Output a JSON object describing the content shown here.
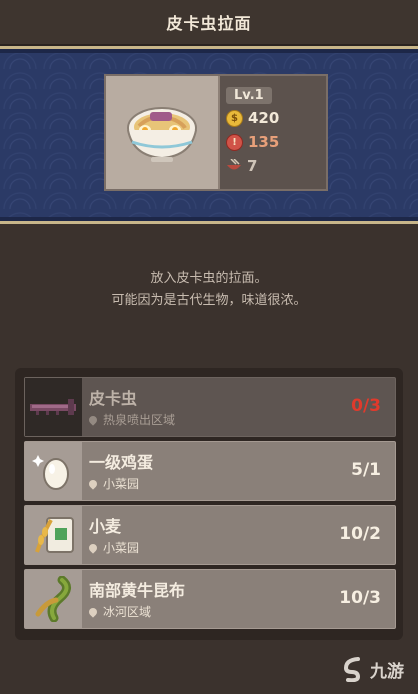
{
  "header": {
    "title": "皮卡虫拉面"
  },
  "dish": {
    "level": "Lv.1",
    "price": "420",
    "popularity": "135",
    "servings": "7",
    "colors": {
      "price": "#f2e8d8",
      "popularity": "#e8a07a",
      "servings": "#cfc4b8"
    }
  },
  "description": {
    "line1": "放入皮卡虫的拉面。",
    "line2": "可能因为是古代生物，味道很浓。"
  },
  "ingredients": [
    {
      "name": "皮卡虫",
      "location": "热泉喷出区域",
      "count": "0/3",
      "icon": "pikabug-icon",
      "sufficient": false
    },
    {
      "name": "一级鸡蛋",
      "location": "小菜园",
      "count": "5/1",
      "icon": "egg-icon",
      "sufficient": true
    },
    {
      "name": "小麦",
      "location": "小菜园",
      "count": "10/2",
      "icon": "wheat-icon",
      "sufficient": true
    },
    {
      "name": "南部黄牛昆布",
      "location": "冰河区域",
      "count": "10/3",
      "icon": "kelp-icon",
      "sufficient": true
    }
  ],
  "watermark": {
    "text": "九游"
  }
}
